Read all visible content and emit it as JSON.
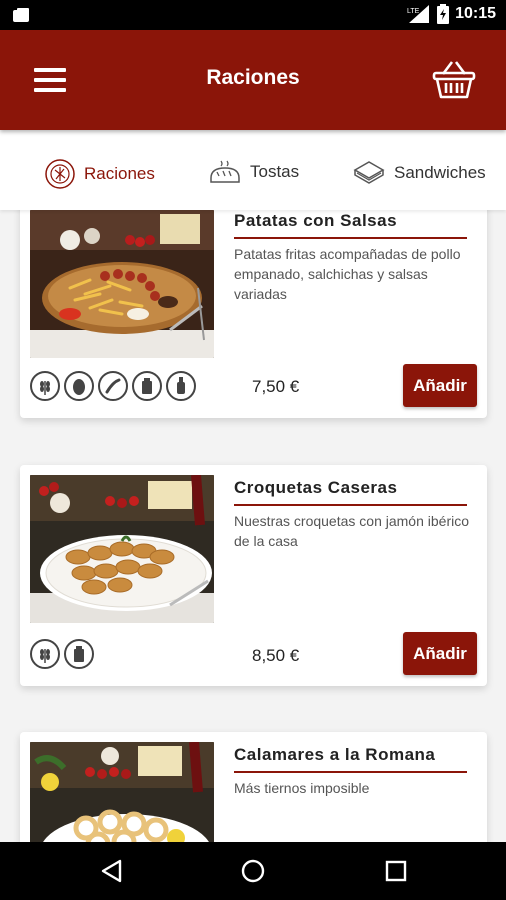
{
  "status_bar": {
    "time": "10:15",
    "network": "LTE"
  },
  "app_bar": {
    "title": "Raciones"
  },
  "tabs": [
    {
      "label": "Raciones",
      "icon": "plate-icon",
      "active": true
    },
    {
      "label": "Tostas",
      "icon": "bread-icon",
      "active": false
    },
    {
      "label": "Sandwiches",
      "icon": "sandwich-icon",
      "active": false
    }
  ],
  "products": [
    {
      "name": "Patatas con Salsas",
      "description": "Patatas fritas acompañadas de pollo empanado, salchichas y salsas variadas",
      "price": "7,50 €",
      "add_label": "Añadir",
      "allergens": [
        "gluten-icon",
        "egg-icon",
        "sesame-icon",
        "milk-icon",
        "mustard-icon"
      ]
    },
    {
      "name": "Croquetas Caseras",
      "description": "Nuestras croquetas con jamón ibérico de la casa",
      "price": "8,50 €",
      "add_label": "Añadir",
      "allergens": [
        "gluten-icon",
        "milk-icon"
      ]
    },
    {
      "name": "Calamares a la Romana",
      "description": "Más tiernos imposible"
    }
  ],
  "colors": {
    "brand": "#8b1509",
    "background": "#f3f3f3"
  }
}
